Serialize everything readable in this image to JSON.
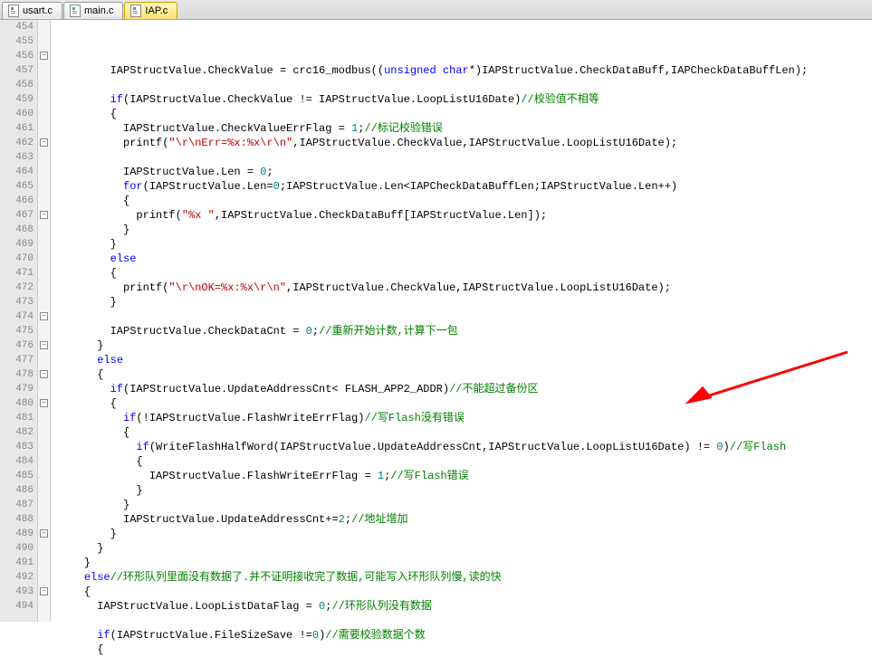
{
  "tabs": [
    {
      "label": "usart.c",
      "active": false
    },
    {
      "label": "main.c",
      "active": false
    },
    {
      "label": "IAP.c",
      "active": true
    }
  ],
  "first_line": 454,
  "last_line": 494,
  "lines": [
    {
      "n": 454,
      "indent": "        ",
      "tokens": [
        [
          "",
          "IAPStructValue.CheckValue = crc16_modbus(("
        ],
        [
          "kw",
          "unsigned"
        ],
        [
          "",
          " "
        ],
        [
          "kw",
          "char"
        ],
        [
          "",
          "*)IAPStructValue.CheckDataBuff,IAPCheckDataBuffLen);"
        ]
      ]
    },
    {
      "n": 455,
      "indent": "",
      "tokens": []
    },
    {
      "n": 456,
      "fold": "-",
      "indent": "        ",
      "tokens": [
        [
          "kw",
          "if"
        ],
        [
          "",
          "(IAPStructValue.CheckValue != IAPStructValue.LoopListU16Date)"
        ],
        [
          "cmt",
          "//校验值不相等"
        ]
      ]
    },
    {
      "n": 457,
      "indent": "        ",
      "tokens": [
        [
          "",
          "{"
        ]
      ]
    },
    {
      "n": 458,
      "indent": "          ",
      "tokens": [
        [
          "",
          "IAPStructValue.CheckValueErrFlag = "
        ],
        [
          "num",
          "1"
        ],
        [
          "",
          ";"
        ],
        [
          "cmt",
          "//标记校验错误"
        ]
      ]
    },
    {
      "n": 459,
      "indent": "          ",
      "tokens": [
        [
          "",
          "printf("
        ],
        [
          "str",
          "\"\\r\\nErr=%x:%x\\r\\n\""
        ],
        [
          "",
          ",IAPStructValue.CheckValue,IAPStructValue.LoopListU16Date);"
        ]
      ]
    },
    {
      "n": 460,
      "indent": "",
      "tokens": []
    },
    {
      "n": 461,
      "indent": "          ",
      "tokens": [
        [
          "",
          "IAPStructValue.Len = "
        ],
        [
          "num",
          "0"
        ],
        [
          "",
          ";"
        ]
      ]
    },
    {
      "n": 462,
      "fold": "-",
      "indent": "          ",
      "tokens": [
        [
          "kw",
          "for"
        ],
        [
          "",
          "(IAPStructValue.Len="
        ],
        [
          "num",
          "0"
        ],
        [
          "",
          ";IAPStructValue.Len<IAPCheckDataBuffLen;IAPStructValue.Len++)"
        ]
      ]
    },
    {
      "n": 463,
      "indent": "          ",
      "tokens": [
        [
          "",
          "{"
        ]
      ]
    },
    {
      "n": 464,
      "indent": "            ",
      "tokens": [
        [
          "",
          "printf("
        ],
        [
          "str",
          "\"%x \""
        ],
        [
          "",
          ",IAPStructValue.CheckDataBuff[IAPStructValue.Len]);"
        ]
      ]
    },
    {
      "n": 465,
      "indent": "          ",
      "tokens": [
        [
          "",
          "}"
        ]
      ]
    },
    {
      "n": 466,
      "indent": "        ",
      "tokens": [
        [
          "",
          "}"
        ]
      ]
    },
    {
      "n": 467,
      "fold": "-",
      "indent": "        ",
      "tokens": [
        [
          "kw",
          "else"
        ]
      ]
    },
    {
      "n": 468,
      "indent": "        ",
      "tokens": [
        [
          "",
          "{"
        ]
      ]
    },
    {
      "n": 469,
      "indent": "          ",
      "tokens": [
        [
          "",
          "printf("
        ],
        [
          "str",
          "\"\\r\\nOK=%x:%x\\r\\n\""
        ],
        [
          "",
          ",IAPStructValue.CheckValue,IAPStructValue.LoopListU16Date);"
        ]
      ]
    },
    {
      "n": 470,
      "indent": "        ",
      "tokens": [
        [
          "",
          "}"
        ]
      ]
    },
    {
      "n": 471,
      "indent": "",
      "tokens": []
    },
    {
      "n": 472,
      "indent": "        ",
      "tokens": [
        [
          "",
          "IAPStructValue.CheckDataCnt = "
        ],
        [
          "num",
          "0"
        ],
        [
          "",
          ";"
        ],
        [
          "cmt",
          "//重新开始计数,计算下一包"
        ]
      ]
    },
    {
      "n": 473,
      "indent": "      ",
      "tokens": [
        [
          "",
          "}"
        ]
      ]
    },
    {
      "n": 474,
      "fold": "-",
      "indent": "      ",
      "tokens": [
        [
          "kw",
          "else"
        ]
      ]
    },
    {
      "n": 475,
      "indent": "      ",
      "tokens": [
        [
          "",
          "{"
        ]
      ]
    },
    {
      "n": 476,
      "fold": "-",
      "indent": "        ",
      "tokens": [
        [
          "kw",
          "if"
        ],
        [
          "",
          "(IAPStructValue.UpdateAddressCnt< FLASH_APP2_ADDR)"
        ],
        [
          "cmt",
          "//不能超过备份区"
        ]
      ]
    },
    {
      "n": 477,
      "indent": "        ",
      "tokens": [
        [
          "",
          "{"
        ]
      ]
    },
    {
      "n": 478,
      "fold": "-",
      "indent": "          ",
      "tokens": [
        [
          "kw",
          "if"
        ],
        [
          "",
          "(!IAPStructValue.FlashWriteErrFlag)"
        ],
        [
          "cmt",
          "//写Flash没有错误"
        ]
      ]
    },
    {
      "n": 479,
      "indent": "          ",
      "tokens": [
        [
          "",
          "{"
        ]
      ]
    },
    {
      "n": 480,
      "fold": "-",
      "indent": "            ",
      "tokens": [
        [
          "kw",
          "if"
        ],
        [
          "",
          "(WriteFlashHalfWord(IAPStructValue.UpdateAddressCnt,IAPStructValue.LoopListU16Date) != "
        ],
        [
          "num",
          "0"
        ],
        [
          "",
          ")"
        ],
        [
          "cmt",
          "//写Flash"
        ]
      ]
    },
    {
      "n": 481,
      "indent": "            ",
      "tokens": [
        [
          "",
          "{"
        ]
      ]
    },
    {
      "n": 482,
      "indent": "              ",
      "tokens": [
        [
          "",
          "IAPStructValue.FlashWriteErrFlag = "
        ],
        [
          "num",
          "1"
        ],
        [
          "",
          ";"
        ],
        [
          "cmt",
          "//写Flash错误"
        ]
      ]
    },
    {
      "n": 483,
      "indent": "            ",
      "tokens": [
        [
          "",
          "}"
        ]
      ]
    },
    {
      "n": 484,
      "indent": "          ",
      "tokens": [
        [
          "",
          "}"
        ]
      ]
    },
    {
      "n": 485,
      "indent": "          ",
      "tokens": [
        [
          "",
          "IAPStructValue.UpdateAddressCnt+="
        ],
        [
          "num",
          "2"
        ],
        [
          "",
          ";"
        ],
        [
          "cmt",
          "//地址增加"
        ]
      ]
    },
    {
      "n": 486,
      "indent": "        ",
      "tokens": [
        [
          "",
          "}"
        ]
      ]
    },
    {
      "n": 487,
      "indent": "      ",
      "tokens": [
        [
          "",
          "}"
        ]
      ]
    },
    {
      "n": 488,
      "indent": "    ",
      "tokens": [
        [
          "",
          "}"
        ]
      ]
    },
    {
      "n": 489,
      "fold": "-",
      "indent": "    ",
      "tokens": [
        [
          "kw",
          "else"
        ],
        [
          "cmt",
          "//环形队列里面没有数据了.并不证明接收完了数据,可能写入环形队列慢,读的快"
        ]
      ]
    },
    {
      "n": 490,
      "indent": "    ",
      "tokens": [
        [
          "",
          "{"
        ]
      ]
    },
    {
      "n": 491,
      "indent": "      ",
      "tokens": [
        [
          "",
          "IAPStructValue.LoopListDataFlag = "
        ],
        [
          "num",
          "0"
        ],
        [
          "",
          ";"
        ],
        [
          "cmt",
          "//环形队列没有数据"
        ]
      ]
    },
    {
      "n": 492,
      "indent": "",
      "tokens": []
    },
    {
      "n": 493,
      "fold": "-",
      "indent": "      ",
      "tokens": [
        [
          "kw",
          "if"
        ],
        [
          "",
          "(IAPStructValue.FileSizeSave !="
        ],
        [
          "num",
          "0"
        ],
        [
          "",
          ")"
        ],
        [
          "cmt",
          "//需要校验数据个数"
        ]
      ]
    },
    {
      "n": 494,
      "indent": "      ",
      "tokens": [
        [
          "",
          "{"
        ]
      ]
    }
  ],
  "annotation": {
    "arrow_target_line": 480
  }
}
